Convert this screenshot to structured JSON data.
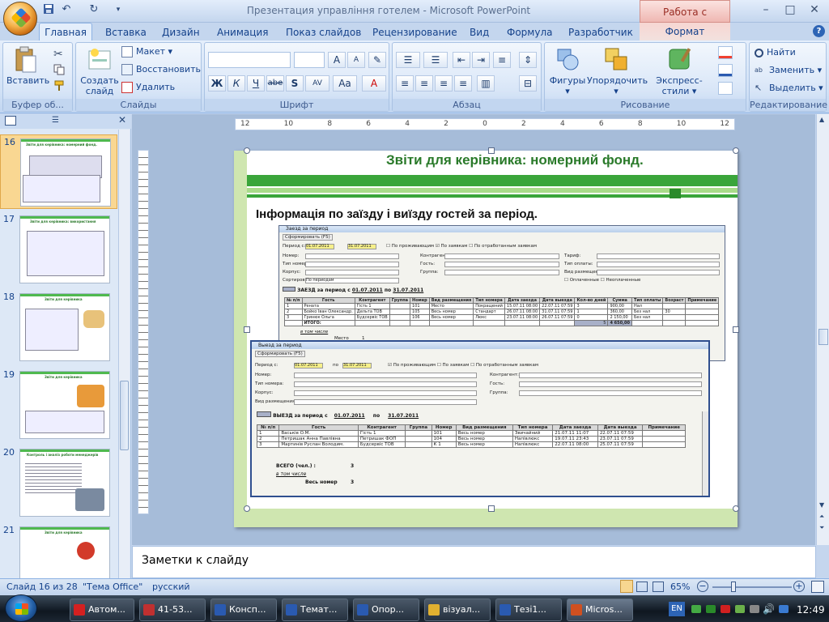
{
  "window": {
    "title": "Презентация управління готелем - Microsoft PowerPoint",
    "context_group": "Работа с рисунк..."
  },
  "qat": {
    "save_icon": "save-icon",
    "undo_icon": "undo-icon",
    "redo_icon": "redo-icon",
    "customize_icon": "dropdown-icon"
  },
  "window_controls": {
    "minimize": "–",
    "maximize": "□",
    "close": "✕"
  },
  "tabs": [
    "Главная",
    "Вставка",
    "Дизайн",
    "Анимация",
    "Показ слайдов",
    "Рецензирование",
    "Вид",
    "Формула",
    "Разработчик"
  ],
  "context_tab": "Формат",
  "help": "?",
  "ribbon": {
    "clipboard": {
      "paste": "Вставить",
      "label": "Буфер об..."
    },
    "slides": {
      "new_slide_line1": "Создать",
      "new_slide_line2": "слайд",
      "layout": "Макет",
      "reset": "Восстановить",
      "delete": "Удалить",
      "label": "Слайды"
    },
    "font": {
      "bold": "Ж",
      "italic": "К",
      "underline": "Ч",
      "strike": "abe",
      "shadow": "S",
      "spacing": "AV",
      "case": "Aa",
      "color": "A",
      "grow": "A",
      "shrink": "A",
      "label": "Шрифт"
    },
    "paragraph": {
      "label": "Абзац"
    },
    "drawing": {
      "shapes": "Фигуры",
      "arrange": "Упорядочить",
      "quick_styles": "Экспресс-стили",
      "label": "Рисование"
    },
    "editing": {
      "find": "Найти",
      "replace": "Заменить",
      "select": "Выделить",
      "label": "Редактирование"
    }
  },
  "thumbnails": [
    {
      "num": "16",
      "title": "Звіти для керівника: номерний фонд."
    },
    {
      "num": "17",
      "title": "Звіти для керівника: використання"
    },
    {
      "num": "18",
      "title": "Звіти для керівника"
    },
    {
      "num": "19",
      "title": "Звіти для керівника"
    },
    {
      "num": "20",
      "title": "Контроль і аналіз роботи менеджерів"
    },
    {
      "num": "21",
      "title": "Звіти для керівника"
    }
  ],
  "ruler": {
    "h_ticks": [
      "12",
      "10",
      "8",
      "6",
      "4",
      "2",
      "0",
      "2",
      "4",
      "6",
      "8",
      "10",
      "12"
    ]
  },
  "slide": {
    "title": "Звіти для керівника: номерний фонд.",
    "subtitle": "Інформація по заїзду і виїзду гостей за період.",
    "checkin": {
      "window_title": "Заезд за период",
      "toolbar": "Сформировать (F5)",
      "period_label": "Период с:",
      "date_from": "01.07.2011",
      "date_to": "31.07.2011",
      "chk1": "По проживающим",
      "chk2": "По заявкам",
      "chk3": "По отработанным заявкам",
      "fields": [
        "Номер:",
        "Тип номера:",
        "Корпус:",
        "Сортировка:"
      ],
      "fields2": [
        "Контрагент:",
        "Гость:",
        "Группа:"
      ],
      "fields3": [
        "Тариф:",
        "Тип оплаты:",
        "Вид размещения:"
      ],
      "sort_value": "По периодам",
      "chk4": "Оплаченные",
      "chk5": "Неоплаченные",
      "report_heading": "ЗАЕЗД за период с",
      "report_from": "01.07.2011",
      "report_po": "по",
      "report_to": "31.07.2011",
      "headers": [
        "№ п/п",
        "Гость",
        "Контрагент",
        "Группа",
        "Номер",
        "Вид размещения",
        "Тип номера",
        "Дата заезда",
        "Дата выезда",
        "Кол-во дней",
        "Сумма",
        "Тип оплаты",
        "Возраст",
        "Примечание"
      ],
      "rows": [
        [
          "1",
          "Рената",
          "Гість 1",
          "",
          "101",
          "Место",
          "Покращений",
          "15.07.11 08:00",
          "22.07.11 07:59",
          "3",
          "900,00",
          "Нал",
          "",
          ""
        ],
        [
          "2",
          "Бойко Іван Олександр.",
          "Дельта ТОВ",
          "",
          "105",
          "Весь номер",
          "Стандарт",
          "26.07.11 08:00",
          "31.07.11 07:59",
          "1",
          "360,00",
          "Без нал",
          "30",
          ""
        ],
        [
          "3",
          "Гринюк Ольга",
          "Будсервіс ТОВ",
          "",
          "106",
          "Весь номер",
          "Люкс",
          "23.07.11 08:00",
          "26.07.11 07:59",
          "0",
          "2 150,00",
          "Без нал",
          "",
          ""
        ]
      ],
      "total_label": "ИТОГО:",
      "total_count": "5",
      "total_sum": "4 650,00",
      "in_that_label": "в том числе",
      "place_label": "Место",
      "place_value": "1"
    },
    "checkout": {
      "window_title": "Выезд за период",
      "toolbar": "Сформировать (F5)",
      "period_label": "Период с:",
      "date_from": "01.07.2011",
      "po": "по",
      "date_to": "31.07.2011",
      "chk1": "По проживающим",
      "chk2": "По заявкам",
      "chk3": "По отработанным заявкам",
      "fields": [
        "Номер:",
        "Тип номера:",
        "Корпус:",
        "Вид размещения:"
      ],
      "fields2": [
        "Контрагент:",
        "Гость:",
        "Группа:"
      ],
      "report_heading": "ВЫЕЗД за период с",
      "report_from": "01.07.2011",
      "report_po": "по",
      "report_to": "31.07.2011",
      "headers": [
        "№ п/п",
        "Гость",
        "Контрагент",
        "Группа",
        "Номер",
        "Вид размещения",
        "Тип номера",
        "Дата заезда",
        "Дата выезда",
        "Примечание"
      ],
      "rows": [
        [
          "1",
          "Васьків О.М.",
          "Гість 1",
          "",
          "101",
          "Весь номер",
          "Звичайний",
          "21.07.11 11:07",
          "22.07.11 07:59",
          ""
        ],
        [
          "2",
          "Петришак Анна Павлівна",
          "Петришак ФОП",
          "",
          "104",
          "Весь номер",
          "Напівлюкс",
          "19.07.11 23:43",
          "23.07.11 07:59",
          ""
        ],
        [
          "3",
          "Мартинів Руслан Володим.",
          "Будсервіс ТОВ",
          "",
          "К 1",
          "Весь номер",
          "Напівлюкс",
          "22.07.11 08:00",
          "25.07.11 07:59",
          ""
        ]
      ],
      "total_label": "ВСЕГО (чел.) :",
      "total_value": "3",
      "in_that_label": "в том числе",
      "room_label": "Весь номер",
      "room_value": "3"
    }
  },
  "notes": "Заметки к слайду",
  "status": {
    "slide": "Слайд 16 из 28",
    "theme": "\"Тема Office\"",
    "lang": "русский",
    "zoom": "65%"
  },
  "taskbar": {
    "items": [
      {
        "label": "Автом...",
        "color": "#d42020"
      },
      {
        "label": "41-53...",
        "color": "#c03030"
      },
      {
        "label": "Консп...",
        "color": "#2a5ab0"
      },
      {
        "label": "Темат...",
        "color": "#2a5ab0"
      },
      {
        "label": "Опор...",
        "color": "#2a5ab0"
      },
      {
        "label": "візуал...",
        "color": "#e0b030"
      },
      {
        "label": "Тезі1...",
        "color": "#2a5ab0"
      },
      {
        "label": "Micros...",
        "color": "#d05020"
      }
    ],
    "lang": "EN",
    "time": "12:49"
  }
}
